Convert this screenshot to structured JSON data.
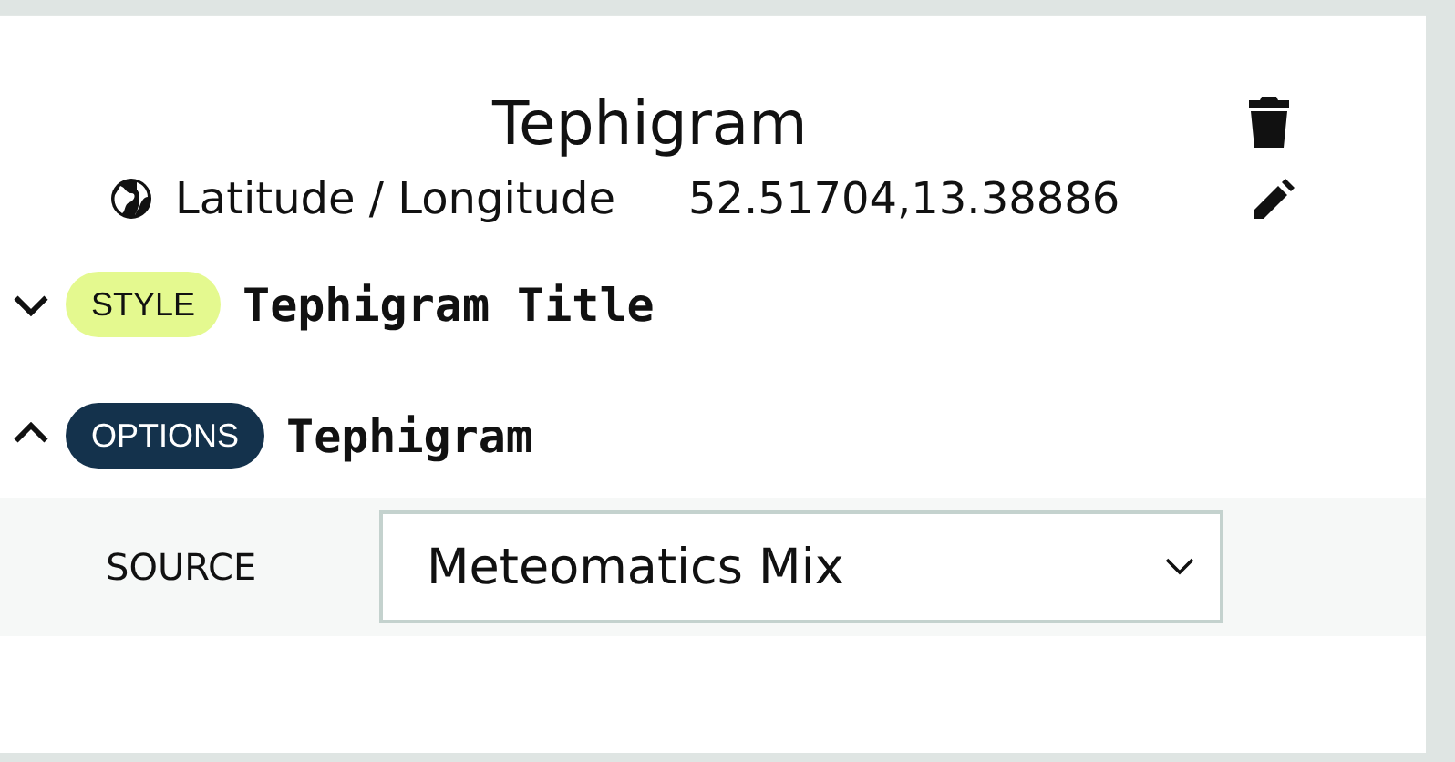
{
  "panel": {
    "title": "Tephigram",
    "location_label": "Latitude / Longitude",
    "location_value": "52.51704,13.38886"
  },
  "sections": [
    {
      "kind": "style",
      "badge": "STYLE",
      "title": "Tephigram Title",
      "expanded": false
    },
    {
      "kind": "options",
      "badge": "OPTIONS",
      "title": "Tephigram",
      "expanded": true,
      "fields": [
        {
          "label": "SOURCE",
          "value": "Meteomatics Mix"
        }
      ]
    }
  ]
}
